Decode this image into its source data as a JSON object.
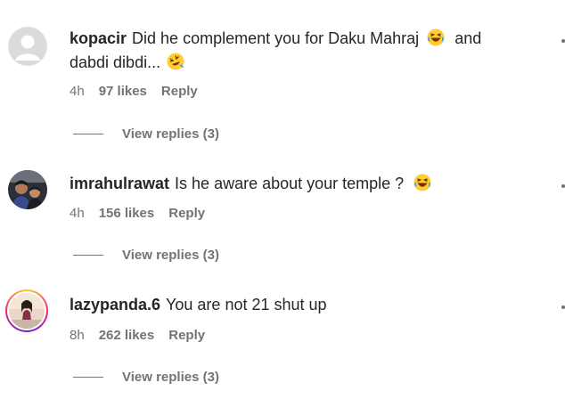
{
  "comments": [
    {
      "username": "kopacir",
      "text": "Did he complement you for Daku Mahraj",
      "text_cont": "and",
      "text_line2": "dabdi dibdi...",
      "time": "4h",
      "likes": "97 likes",
      "reply": "Reply",
      "view_replies": "View replies (3)",
      "avatar": "default-avatar-icon"
    },
    {
      "username": "imrahulrawat",
      "text": "Is he aware about your temple ?",
      "time": "4h",
      "likes": "156 likes",
      "reply": "Reply",
      "view_replies": "View replies (3)",
      "avatar": "photo-avatar"
    },
    {
      "username": "lazypanda.6",
      "text": "You are not 21 shut up",
      "time": "8h",
      "likes": "262 likes",
      "reply": "Reply",
      "view_replies": "View replies (3)",
      "avatar": "story-ring-avatar"
    }
  ],
  "colors": {
    "text": "#262626",
    "muted": "#737373",
    "story_ring": "#ee2a7b"
  }
}
